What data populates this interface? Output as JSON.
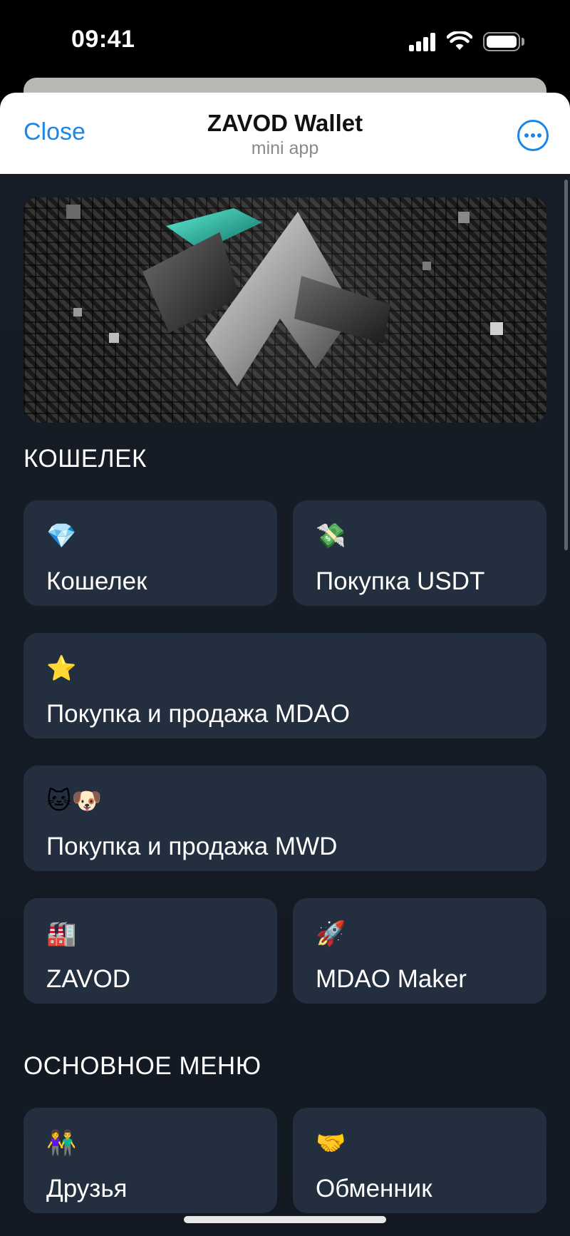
{
  "status_bar": {
    "time": "09:41"
  },
  "header": {
    "close_label": "Close",
    "title": "ZAVOD Wallet",
    "subtitle": "mini app"
  },
  "sections": [
    {
      "title": "КОШЕЛЕК",
      "tiles": [
        {
          "icon": "gem-icon",
          "emoji": "💎",
          "label": "Кошелек"
        },
        {
          "icon": "money-with-wings-icon",
          "emoji": "💸",
          "label": "Покупка USDT"
        },
        {
          "icon": "star-icon",
          "emoji": "⭐",
          "label": "Покупка и продажа MDAO"
        },
        {
          "icon": "cat-dog-icon",
          "emoji": "🐱🐶",
          "label": "Покупка и продажа MWD"
        },
        {
          "icon": "factory-icon",
          "emoji": "🏭",
          "label": "ZAVOD"
        },
        {
          "icon": "rocket-icon",
          "emoji": "🚀",
          "label": "MDAO Maker"
        }
      ]
    },
    {
      "title": "ОСНОВНОЕ МЕНЮ",
      "tiles": [
        {
          "icon": "people-icon",
          "emoji": "👫",
          "label": "Друзья"
        },
        {
          "icon": "handshake-icon",
          "emoji": "🤝",
          "label": "Обменник"
        }
      ]
    }
  ],
  "colors": {
    "accent": "#1a86e8",
    "background": "#161d27",
    "tile": "#232e3f",
    "banner_teal": "#3fe0c4"
  }
}
